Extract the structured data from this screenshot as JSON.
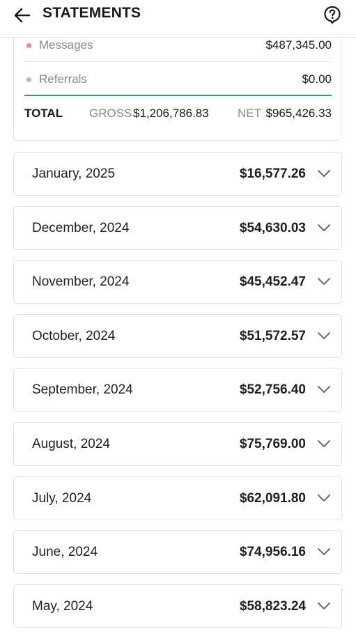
{
  "header": {
    "title": "STATEMENTS",
    "back_icon": "arrow-left-icon",
    "help_icon": "help-circle-icon"
  },
  "summary": {
    "rows": [
      {
        "label": "Messages",
        "value": "$487,345.00",
        "dot_color": "#f28b82"
      },
      {
        "label": "Referrals",
        "value": "$0.00",
        "dot_color": "#b9b3e6"
      }
    ],
    "total_label": "TOTAL",
    "gross_label": "GROSS",
    "gross_value": "$1,206,786.83",
    "net_label": "NET",
    "net_value": "$965,426.33",
    "accent_color": "#0c9bb0"
  },
  "months": [
    {
      "name": "January, 2025",
      "amount": "$16,577.26"
    },
    {
      "name": "December, 2024",
      "amount": "$54,630.03"
    },
    {
      "name": "November, 2024",
      "amount": "$45,452.47"
    },
    {
      "name": "October, 2024",
      "amount": "$51,572.57"
    },
    {
      "name": "September, 2024",
      "amount": "$52,756.40"
    },
    {
      "name": "August, 2024",
      "amount": "$75,769.00"
    },
    {
      "name": "July, 2024",
      "amount": "$62,091.80"
    },
    {
      "name": "June, 2024",
      "amount": "$74,956.16"
    },
    {
      "name": "May, 2024",
      "amount": "$58,823.24"
    }
  ]
}
